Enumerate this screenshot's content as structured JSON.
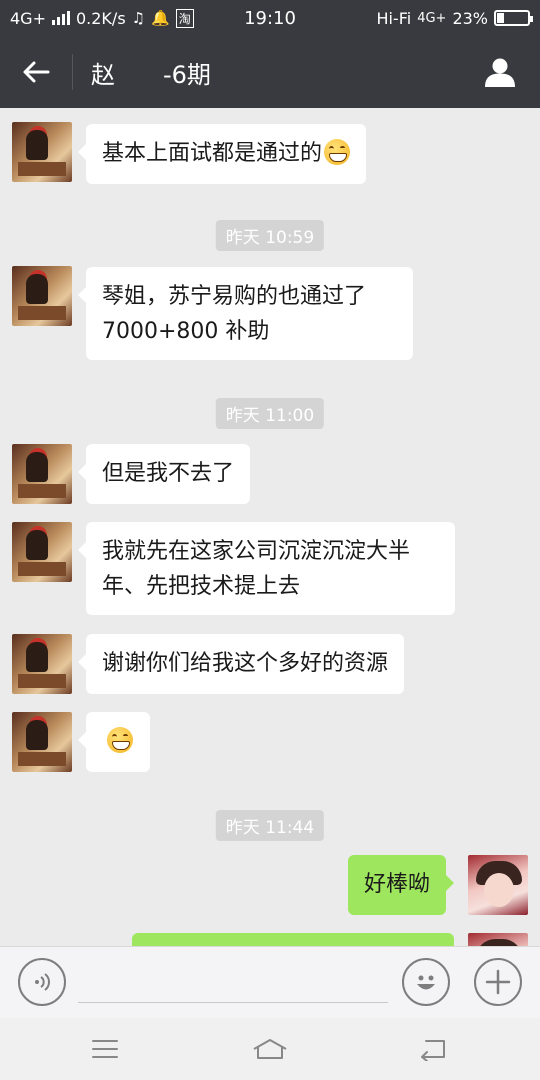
{
  "status_bar": {
    "network": "4G+",
    "speed": "0.2K/s",
    "app_badge": "淘",
    "time": "19:10",
    "audio": "Hi-Fi",
    "network_right": "4G+",
    "battery": "23%"
  },
  "header": {
    "title": "赵　　-6期",
    "back_icon": "arrow-left-icon",
    "profile_icon": "person-icon"
  },
  "messages": [
    {
      "side": "left",
      "text": "基本上面试都是通过的",
      "emoji": "grin"
    },
    {
      "type": "time",
      "text": "昨天 10:59"
    },
    {
      "side": "left",
      "line1": "琴姐，苏宁易购的也通过了",
      "line2": "7000+800 补助"
    },
    {
      "type": "time",
      "text": "昨天 11:00"
    },
    {
      "side": "left",
      "text": "但是我不去了"
    },
    {
      "side": "left",
      "line1": "我就先在这家公司沉淀沉淀大半",
      "line2": "年、先把技术提上去"
    },
    {
      "side": "left",
      "text": "谢谢你们给我这个多好的资源"
    },
    {
      "side": "left",
      "emoji_only": "grin"
    },
    {
      "type": "time",
      "text": "昨天 11:44"
    },
    {
      "side": "right",
      "text": "好棒呦"
    }
  ],
  "input": {
    "value": "",
    "voice_icon": "voice-icon",
    "emoji_icon": "emoji-icon",
    "plus_icon": "plus-icon"
  },
  "nav": {
    "menu_icon": "menu-icon",
    "home_icon": "home-icon",
    "back_icon": "back-icon"
  }
}
